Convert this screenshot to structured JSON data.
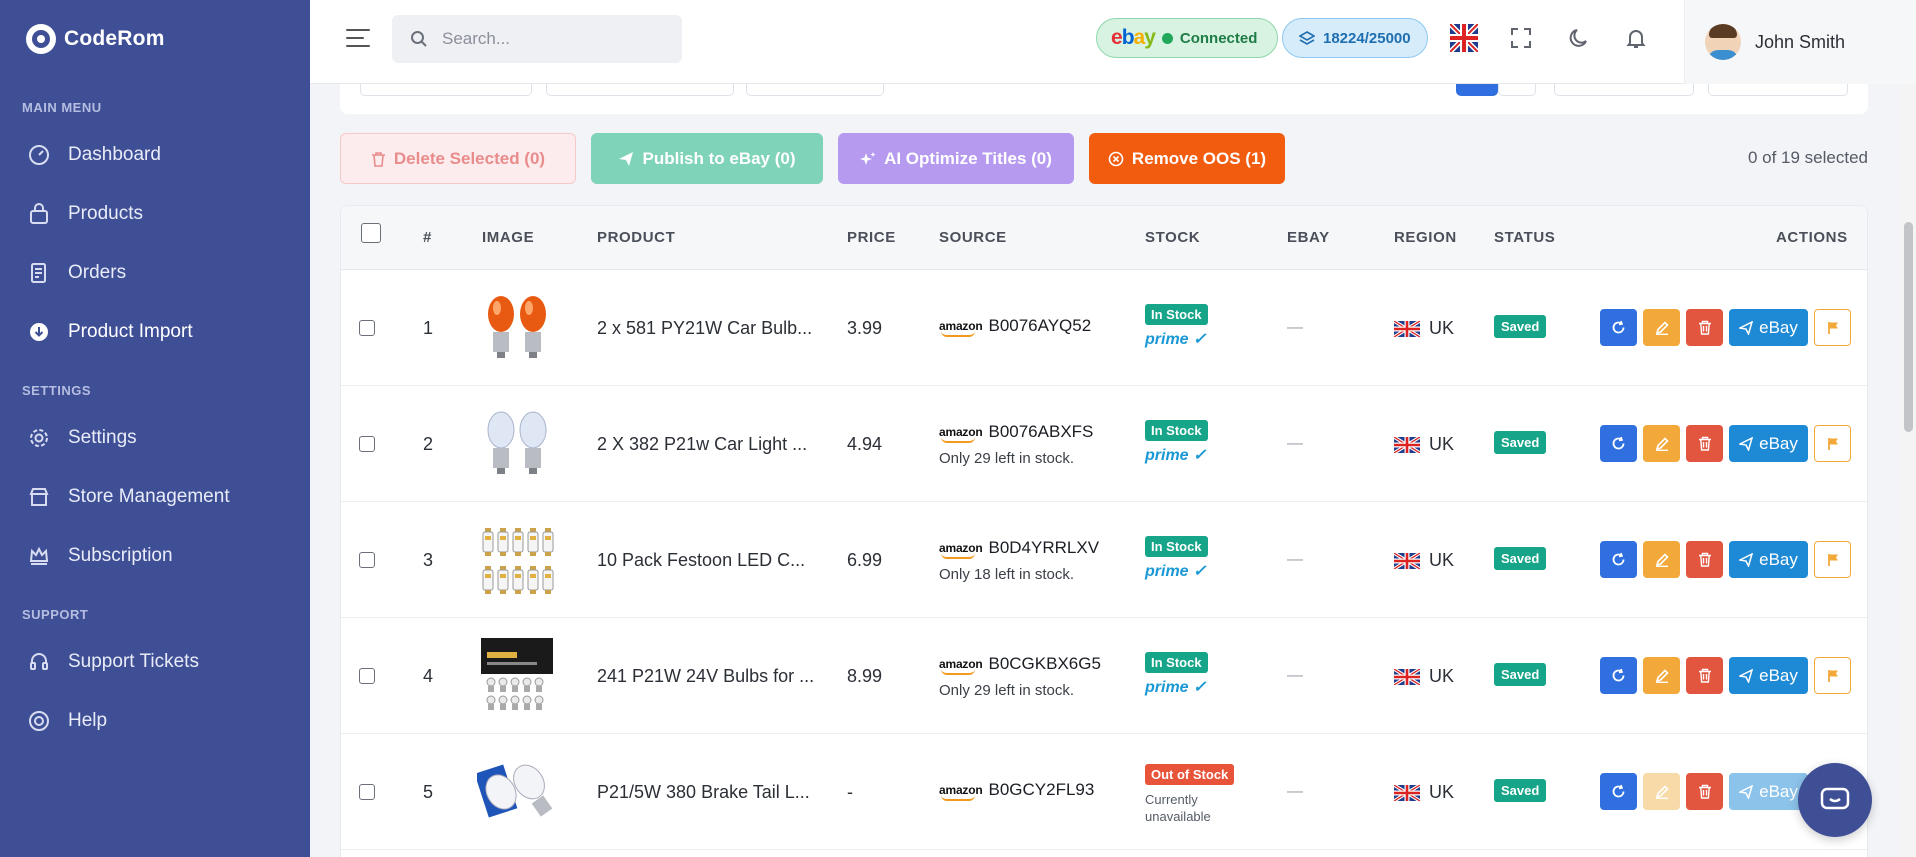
{
  "app": {
    "brand": "CodeRom"
  },
  "sidebar": {
    "sections": [
      {
        "label": "MAIN MENU"
      },
      {
        "label": "SETTINGS"
      },
      {
        "label": "SUPPORT"
      }
    ],
    "items": [
      {
        "label": "Dashboard",
        "icon": "dashboard-icon"
      },
      {
        "label": "Products",
        "icon": "bag-icon"
      },
      {
        "label": "Orders",
        "icon": "orders-icon"
      },
      {
        "label": "Product Import",
        "icon": "import-icon",
        "active": true
      },
      {
        "label": "Settings",
        "icon": "gear-icon"
      },
      {
        "label": "Store Management",
        "icon": "store-icon"
      },
      {
        "label": "Subscription",
        "icon": "crown-icon"
      },
      {
        "label": "Support Tickets",
        "icon": "headset-icon"
      },
      {
        "label": "Help",
        "icon": "help-icon"
      }
    ]
  },
  "header": {
    "search_placeholder": "Search...",
    "ebay_status": "Connected",
    "credits": "18224/25000",
    "user_name": "John Smith"
  },
  "actions": {
    "delete": "Delete Selected (0)",
    "publish": "Publish to eBay (0)",
    "ai_optimize": "AI Optimize Titles (0)",
    "remove_oos": "Remove OOS (1)",
    "selected_count": "0 of 19 selected"
  },
  "table": {
    "columns": [
      "#",
      "IMAGE",
      "PRODUCT",
      "PRICE",
      "SOURCE",
      "STOCK",
      "EBAY",
      "REGION",
      "STATUS",
      "ACTIONS"
    ],
    "rows": [
      {
        "num": "1",
        "product": "2 x 581 PY21W Car Bulb...",
        "price": "3.99",
        "source_logo": "amazon",
        "asin": "B0076AYQ52",
        "source_note": "",
        "stock": "In Stock",
        "stock_note": "prime ✓",
        "ebay": "—",
        "region": "UK",
        "status": "Saved",
        "ebay_btn": "eBay",
        "image": "orange-bulbs"
      },
      {
        "num": "2",
        "product": "2 X 382 P21w Car Light ...",
        "price": "4.94",
        "source_logo": "amazon",
        "asin": "B0076ABXFS",
        "source_note": "Only 29 left in stock.",
        "stock": "In Stock",
        "stock_note": "prime ✓",
        "ebay": "—",
        "region": "UK",
        "status": "Saved",
        "ebay_btn": "eBay",
        "image": "clear-bulbs"
      },
      {
        "num": "3",
        "product": "10 Pack Festoon LED C...",
        "price": "6.99",
        "source_logo": "amazon",
        "asin": "B0D4YRRLXV",
        "source_note": "Only 18 left in stock.",
        "stock": "In Stock",
        "stock_note": "prime ✓",
        "ebay": "—",
        "region": "UK",
        "status": "Saved",
        "ebay_btn": "eBay",
        "image": "festoon-leds"
      },
      {
        "num": "4",
        "product": "241 P21W 24V Bulbs for ...",
        "price": "8.99",
        "source_logo": "amazon",
        "asin": "B0CGKBX6G5",
        "source_note": "Only 29 left in stock.",
        "stock": "In Stock",
        "stock_note": "prime ✓",
        "ebay": "—",
        "region": "UK",
        "status": "Saved",
        "ebay_btn": "eBay",
        "image": "boxed-bulbs"
      },
      {
        "num": "5",
        "product": "P21/5W 380 Brake Tail L...",
        "price": "-",
        "source_logo": "amazon",
        "asin": "B0GCY2FL93",
        "source_note": "",
        "stock": "Out of Stock",
        "stock_note": "Currently unavailable",
        "ebay": "—",
        "region": "UK",
        "status": "Saved",
        "ebay_btn": "eBay",
        "image": "brake-bulbs"
      }
    ]
  },
  "colors": {
    "sidebar_bg": "#3f4f96",
    "in_stock": "#17a589",
    "out_of_stock": "#e8543a",
    "publish": "#7fd3b8",
    "ai": "#b69af0",
    "remove_oos": "#f25c0e"
  }
}
